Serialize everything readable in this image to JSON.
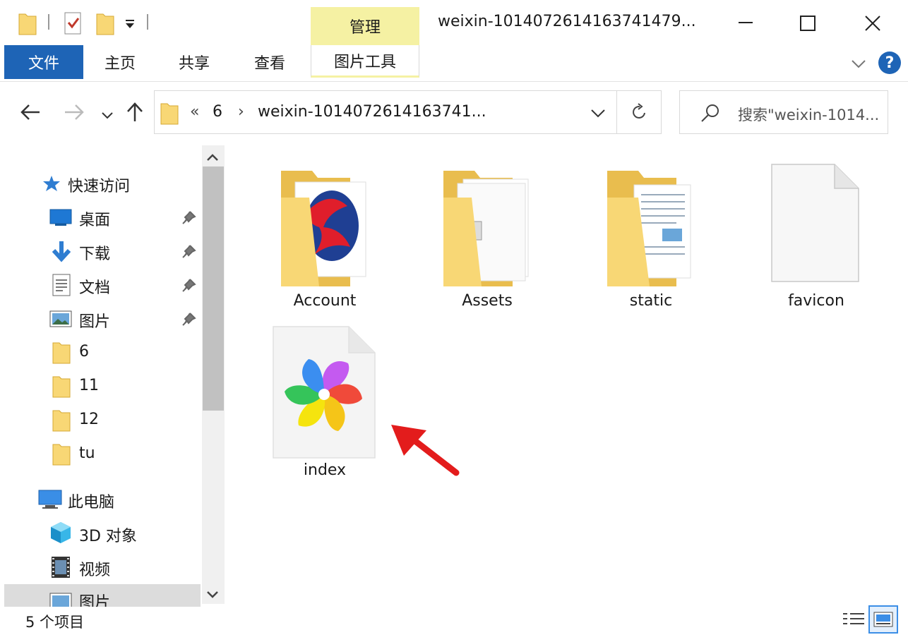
{
  "titlebar": {
    "title": "weixin-1014072614163741479...",
    "context_tab": "管理",
    "controls": [
      "minimize-icon",
      "maximize-icon",
      "close-icon"
    ]
  },
  "ribbon": {
    "tabs": [
      "文件",
      "主页",
      "共享",
      "查看",
      "图片工具"
    ],
    "help_icon": "?"
  },
  "address": {
    "overflow": "«",
    "crumbs": [
      "6",
      "weixin-1014072614163741..."
    ],
    "separator": "›"
  },
  "search": {
    "placeholder": "搜索\"weixin-1014..."
  },
  "nav": {
    "quick_access": "快速访问",
    "pinned": [
      {
        "label": "桌面",
        "icon": "desktop-icon"
      },
      {
        "label": "下载",
        "icon": "download-icon"
      },
      {
        "label": "文档",
        "icon": "documents-icon"
      },
      {
        "label": "图片",
        "icon": "pictures-icon"
      }
    ],
    "folders": [
      "6",
      "11",
      "12",
      "tu"
    ],
    "this_pc": "此电脑",
    "pc_items": [
      {
        "label": "3D 对象",
        "icon": "3d-objects-icon"
      },
      {
        "label": "视频",
        "icon": "videos-icon"
      },
      {
        "label": "图片",
        "icon": "pictures-icon"
      }
    ]
  },
  "files": [
    {
      "name": "Account",
      "type": "folder"
    },
    {
      "name": "Assets",
      "type": "folder"
    },
    {
      "name": "static",
      "type": "folder"
    },
    {
      "name": "favicon",
      "type": "file"
    },
    {
      "name": "index",
      "type": "html"
    }
  ],
  "status": {
    "count": "5 个项目"
  },
  "colors": {
    "file_tab": "#1e64b6",
    "context_tab": "#f5f1a3",
    "folder": "#f8d775",
    "arrow": "#e31c1c"
  }
}
